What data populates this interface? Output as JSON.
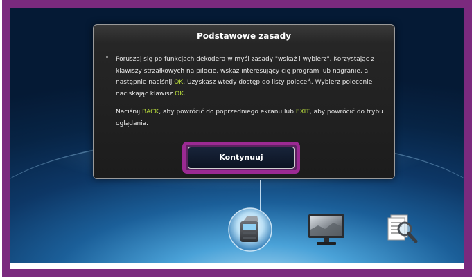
{
  "dialog": {
    "title": "Podstawowe zasady",
    "para1": {
      "t1": "Poruszaj się po funkcjach dekodera w myśl zasady \"wskaż i wybierz\". Korzystając z klawiszy strzałkowych na pilocie, wskaż interesujący cię program lub nagranie, a następnie naciśnij ",
      "k1": "OK",
      "t2": ". Uzyskasz wtedy dostęp do listy poleceń. Wybierz polecenie naciskając klawisz ",
      "k2": "OK",
      "t3": "."
    },
    "para2": {
      "t1": "Naciśnij ",
      "k1": "BACK",
      "t2": ", aby powrócić do poprzedniego ekranu lub ",
      "k2": "EXIT",
      "t3": ", aby powrócić do trybu oglądania."
    },
    "continue_label": "Kontynuuj"
  },
  "menu_icons": [
    {
      "icon": "recorder-icon",
      "selected": true
    },
    {
      "icon": "tv-icon",
      "selected": false
    },
    {
      "icon": "search-document-icon",
      "selected": false
    }
  ],
  "colors": {
    "frame": "#7b2a7e",
    "highlight_key": "#b8dc3c",
    "focus_ring": "#9b2a93"
  }
}
